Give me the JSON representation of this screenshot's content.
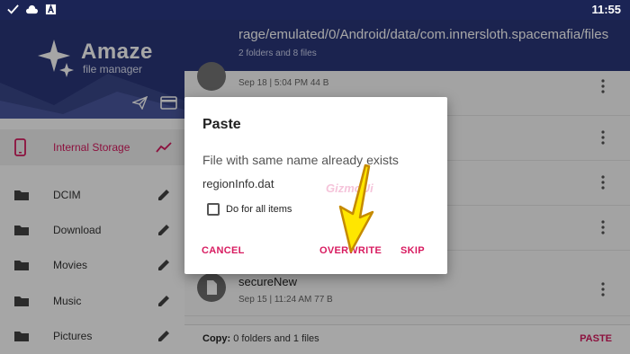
{
  "status_bar": {
    "time": "11:55"
  },
  "drawer": {
    "app_name": "Amaze",
    "app_subtitle": "file manager",
    "storage": {
      "label": "Internal Storage"
    },
    "folders": [
      {
        "label": "DCIM"
      },
      {
        "label": "Download"
      },
      {
        "label": "Movies"
      },
      {
        "label": "Music"
      },
      {
        "label": "Pictures"
      }
    ]
  },
  "main": {
    "path": "rage/emulated/0/Android/data/com.innersloth.spacemafia/files",
    "summary": "2 folders and 8 files",
    "files": [
      {
        "name": "",
        "meta": "Sep 18 | 5:04 PM   44 B"
      },
      {
        "name": "secureNew",
        "meta": "Sep 15 | 11:24 AM   77 B"
      }
    ],
    "copy_bar": {
      "label": "Copy:",
      "text": "0 folders and 1 files",
      "action": "PASTE"
    }
  },
  "dialog": {
    "title": "Paste",
    "message": "File with same name already exists",
    "filename": "regionInfo.dat",
    "checkbox_label": "Do for all items",
    "checkbox_checked": false,
    "cancel": "CANCEL",
    "overwrite": "OVERWRITE",
    "skip": "SKIP"
  },
  "colors": {
    "primary": "#2a367a",
    "accent": "#d81b60",
    "arrow": "#ffe600"
  }
}
